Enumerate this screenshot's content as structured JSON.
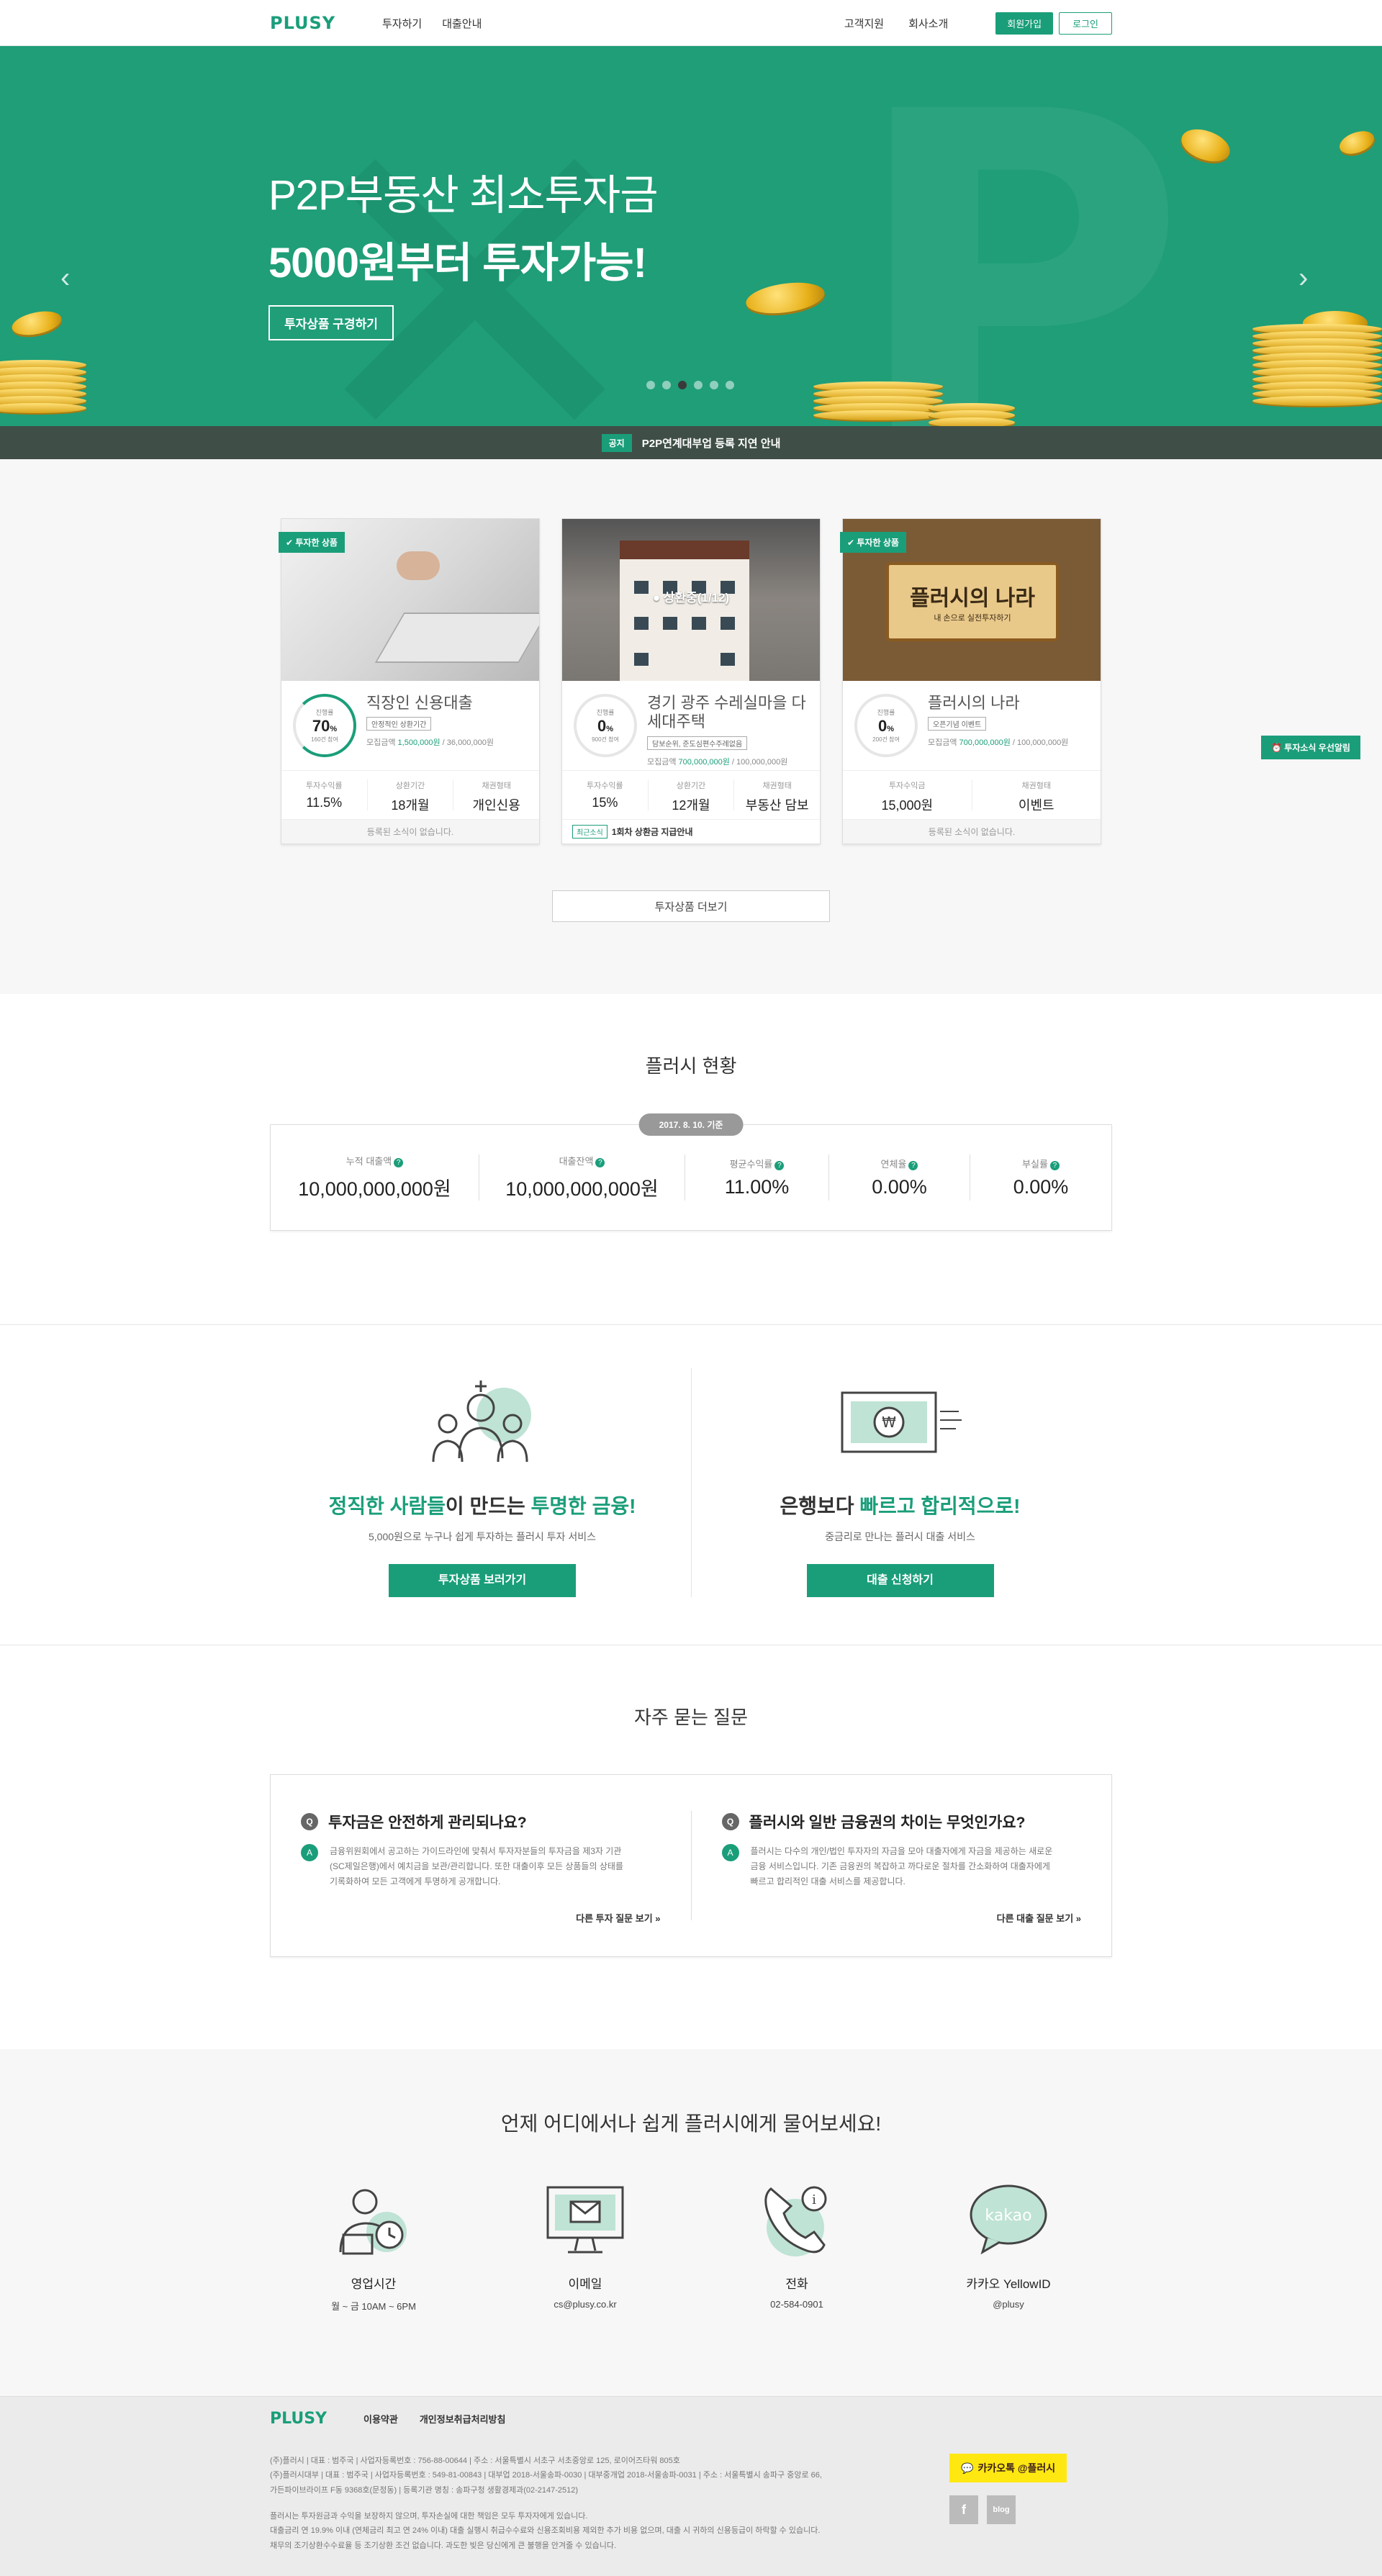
{
  "header": {
    "logo": "PLUSY",
    "nav_left": [
      "투자하기",
      "대출안내"
    ],
    "nav_right": [
      "고객지원",
      "회사소개"
    ],
    "join": "회원가입",
    "login": "로그인"
  },
  "hero": {
    "line1": "P2P부동산 최소투자금",
    "line2": "5000원부터 투자가능!",
    "button": "투자상품 구경하기",
    "slide_count": 6,
    "active_slide": 3
  },
  "notice": {
    "tag": "공지",
    "text": "P2P연계대부업 등록 지연 안내"
  },
  "side_alert": "투자소식 우선알림",
  "products": [
    {
      "badge": "투자한 상품",
      "title": "직장인 신용대출",
      "tag": "안정적인 상환기간",
      "gauge_label": "진행률",
      "gauge_value": "70",
      "gauge_unit": "%",
      "gauge_sub": "160건 참여",
      "amount_label": "모집금액",
      "amount_now": "1,500,000원",
      "amount_total": " / 36,000,000원",
      "stats": [
        {
          "label": "투자수익률",
          "value": "11.5%"
        },
        {
          "label": "상환기간",
          "value": "18개월"
        },
        {
          "label": "채권형태",
          "value": "개인신용"
        }
      ],
      "footer": "등록된 소식이 없습니다."
    },
    {
      "overlay": "상환중(1/12)",
      "title": "경기 광주 수레실마을 다세대주택",
      "tag": "담보순위, 준도심편수주례없음",
      "gauge_label": "진행률",
      "gauge_value": "0",
      "gauge_unit": "%",
      "gauge_sub": "900건 참여",
      "amount_label": "모집금액",
      "amount_now": "700,000,000원",
      "amount_total": " / 100,000,000원",
      "stats": [
        {
          "label": "투자수익률",
          "value": "15%"
        },
        {
          "label": "상환기간",
          "value": "12개월"
        },
        {
          "label": "채권형태",
          "value": "부동산 담보"
        }
      ],
      "news_tag": "최근소식",
      "footer": "1회차 상환금 지급안내"
    },
    {
      "badge": "투자한 상품",
      "scroll_big": "플러시의 나라",
      "scroll_small": "내 손으로 실전투자하기",
      "title": "플러시의 나라",
      "tag": "오픈기념 이벤트",
      "gauge_label": "진행률",
      "gauge_value": "0",
      "gauge_unit": "%",
      "gauge_sub": "200건 참여",
      "amount_label": "모집금액",
      "amount_now": "700,000,000원",
      "amount_total": " / 100,000,000원",
      "stats": [
        {
          "label": "투자수익금",
          "value": "15,000원"
        },
        {
          "label": "채권형태",
          "value": "이벤트"
        }
      ],
      "footer": "등록된 소식이 없습니다."
    }
  ],
  "more_products": "투자상품 더보기",
  "status": {
    "title": "플러시 현황",
    "date": "2017. 8. 10. 기준",
    "items": [
      {
        "label": "누적 대출액",
        "value": "10,000,000,000원"
      },
      {
        "label": "대출잔액",
        "value": "10,000,000,000원"
      },
      {
        "label": "평균수익률",
        "value": "11.00%"
      },
      {
        "label": "연체율",
        "value": "0.00%"
      },
      {
        "label": "부실률",
        "value": "0.00%"
      }
    ]
  },
  "split": {
    "left": {
      "h_g1": "정직한 사람들",
      "h_t1": "이 만드는 ",
      "h_g2": "투명한 금융!",
      "desc": "5,000원으로 누구나 쉽게 투자하는 플러시 투자 서비스",
      "button": "투자상품 보러가기"
    },
    "right": {
      "h_t1": "은행보다 ",
      "h_g1": "빠르고 합리적으로!",
      "desc": "중금리로 만나는 플러시 대출 서비스",
      "button": "대출 신청하기"
    }
  },
  "faq": {
    "title": "자주 묻는 질문",
    "items": [
      {
        "q": "투자금은 안전하게 관리되나요?",
        "a": "금융위원회에서 공고하는 가이드라인에 맞춰서 투자자분들의 투자금을 제3자 기관(SC제일은행)에서 예치금을 보관/관리합니다. 또한 대출이후 모든 상품들의 상태를 기록화하여 모든 고객에게 투명하게 공개합니다.",
        "more": "다른 투자 질문 보기 »"
      },
      {
        "q": "플러시와 일반 금융권의 차이는 무엇인가요?",
        "a": "플러시는 다수의 개인/법인 투자자의 자금을 모아 대출자에게 자금을 제공하는 새로운 금융 서비스입니다. 기존 금융권의 복잡하고 까다로운 절차를 간소화하여 대출자에게 빠르고 합리적인 대출 서비스를 제공합니다.",
        "more": "다른 대출 질문 보기 »"
      }
    ]
  },
  "contact": {
    "title": "언제 어디에서나 쉽게 플러시에게 물어보세요!",
    "items": [
      {
        "name": "영업시간",
        "detail": "월 ~ 금 10AM ~ 6PM"
      },
      {
        "name": "이메일",
        "detail": "cs@plusy.co.kr"
      },
      {
        "name": "전화",
        "detail": "02-584-0901"
      },
      {
        "name": "카카오 YellowID",
        "detail": "@plusy"
      }
    ],
    "kakao_bubble": "kakao"
  },
  "footer": {
    "logo": "PLUSY",
    "links": [
      "이용약관",
      "개인정보취급처리방침"
    ],
    "line1": "(주)플러시 | 대표 : 범주국 | 사업자등록번호 : 756-88-00644 | 주소 : 서울특별시 서초구 서초중앙로 125, 로이어즈타워 805호",
    "line2": "(주)플러시대부 | 대표 : 범주국 | 사업자등록번호 : 549-81-00843 | 대부업 2018-서울송파-0030 | 대부중개업 2018-서울송파-0031 | 주소 : 서울특별시 송파구 중앙로 66,",
    "line3": "가든파이브라이프 F동 9368호(문정동) | 등록기관 명칭 : 송파구청 생활경제과(02-2147-2512)",
    "line4": "플러시는 투자원금과 수익을 보장하지 않으며, 투자손실에 대한 책임은 모두 투자자에게 있습니다.",
    "line5": "대출금리 연 19.9% 이내 (연체금리 최고 연 24% 이내) 대출 실행시 취급수수료와 신용조회비용 제외한 추가 비용 없으며, 대출 시 귀하의 신용등급이 하락할 수 있습니다.",
    "line6": "채무의 조기상환수수료율 등 조기상환 조건 없습니다. 과도한 빚은 당신에게 큰 불행을 안겨줄 수 있습니다.",
    "kakao": "카카오톡 @플러시",
    "sns": [
      "f",
      "blog"
    ]
  }
}
